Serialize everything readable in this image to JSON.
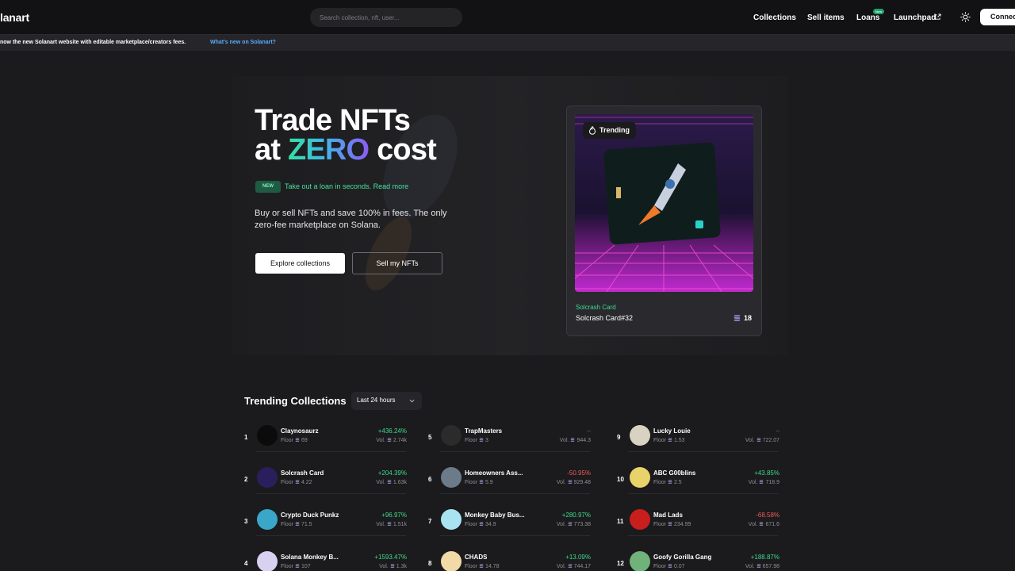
{
  "header": {
    "logo": "lanart",
    "search_placeholder": "Search collection, nft, user...",
    "nav": {
      "collections": "Collections",
      "sell_items": "Sell items",
      "loans": "Loans",
      "loans_badge": "New",
      "launchpad": "Launchpad"
    },
    "connect": "Connect"
  },
  "banner": {
    "text": "now the new Solanart website with editable marketplace/creators fees.",
    "link": "What's new on Solanart?"
  },
  "hero": {
    "title_line1": "Trade NFTs",
    "title_at": "at ",
    "title_zero": "ZERO",
    "title_cost": " cost",
    "new_badge": "NEW",
    "loan_link": "Take out a loan in seconds. Read more",
    "description": "Buy or sell NFTs and save 100% in fees. The only zero-fee marketplace on Solana.",
    "explore_button": "Explore collections",
    "sell_button": "Sell my NFTs"
  },
  "trending_card": {
    "label": "Trending",
    "collection": "Solcrash Card",
    "nft_name": "Solcrash Card#32",
    "price": "18"
  },
  "trending_collections": {
    "title": "Trending Collections",
    "period": "Last 24 hours",
    "floor_label": "Floor",
    "vol_label": "Vol.",
    "items": [
      {
        "rank": "1",
        "name": "Claynosaurz",
        "floor": "69",
        "change": "+436.24%",
        "volume": "2.74k",
        "trend": "up",
        "avatar_color": "#0b0b0b"
      },
      {
        "rank": "2",
        "name": "Solcrash Card",
        "floor": "4.22",
        "change": "+204.39%",
        "volume": "1.63k",
        "trend": "up",
        "avatar_color": "#2a1f5c"
      },
      {
        "rank": "3",
        "name": "Crypto Duck Punkz",
        "floor": "71.5",
        "change": "+96.97%",
        "volume": "1.51k",
        "trend": "up",
        "avatar_color": "#3aa7c9"
      },
      {
        "rank": "4",
        "name": "Solana Monkey B...",
        "floor": "107",
        "change": "+1593.47%",
        "volume": "1.3k",
        "trend": "up",
        "avatar_color": "#d8d2f0"
      },
      {
        "rank": "5",
        "name": "TrapMasters",
        "floor": "3",
        "change": "–",
        "volume": "944.3",
        "trend": "flat",
        "avatar_color": "#2b2b2b"
      },
      {
        "rank": "6",
        "name": "Homeowners Ass...",
        "floor": "5.9",
        "change": "-50.95%",
        "volume": "929.48",
        "trend": "down",
        "avatar_color": "#6b7b8a"
      },
      {
        "rank": "7",
        "name": "Monkey Baby Bus...",
        "floor": "34.9",
        "change": "+280.97%",
        "volume": "773.38",
        "trend": "up",
        "avatar_color": "#a9e3f2"
      },
      {
        "rank": "8",
        "name": "CHADS",
        "floor": "14.78",
        "change": "+13.09%",
        "volume": "744.17",
        "trend": "up",
        "avatar_color": "#f1d9a8"
      },
      {
        "rank": "9",
        "name": "Lucky Louie",
        "floor": "1.53",
        "change": "–",
        "volume": "722.07",
        "trend": "flat",
        "avatar_color": "#d9d2c0"
      },
      {
        "rank": "10",
        "name": "ABC G00blins",
        "floor": "2.5",
        "change": "+43.85%",
        "volume": "718.9",
        "trend": "up",
        "avatar_color": "#e8d36a"
      },
      {
        "rank": "11",
        "name": "Mad Lads",
        "floor": "234.99",
        "change": "-68.58%",
        "volume": "671.6",
        "trend": "down",
        "avatar_color": "#c81e1e"
      },
      {
        "rank": "12",
        "name": "Goofy Gorilla Gang",
        "floor": "0.07",
        "change": "+188.87%",
        "volume": "657.98",
        "trend": "up",
        "avatar_color": "#6fb37a"
      }
    ]
  }
}
